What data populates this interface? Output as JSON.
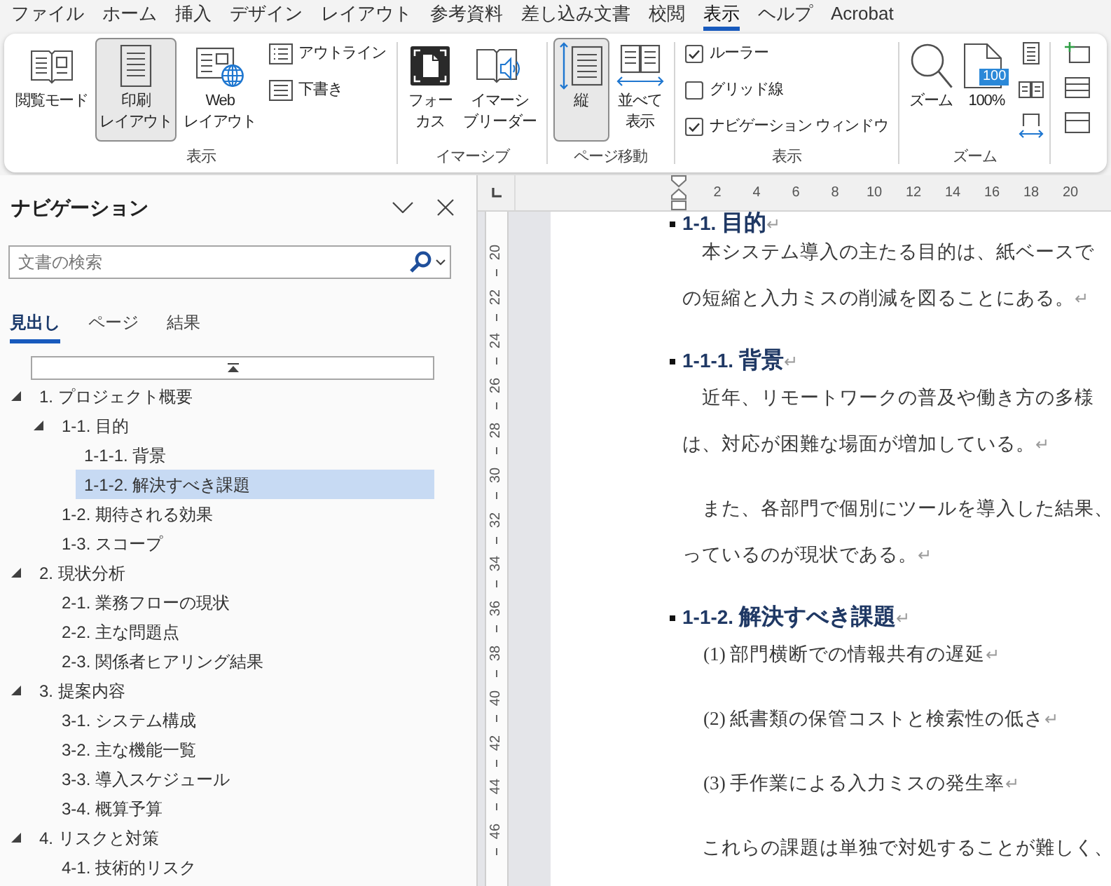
{
  "menu_tabs": [
    {
      "label": "ファイル",
      "selected": false
    },
    {
      "label": "ホーム",
      "selected": false
    },
    {
      "label": "挿入",
      "selected": false
    },
    {
      "label": "デザイン",
      "selected": false
    },
    {
      "label": "レイアウト",
      "selected": false
    },
    {
      "label": "参考資料",
      "selected": false
    },
    {
      "label": "差し込み文書",
      "selected": false
    },
    {
      "label": "校閲",
      "selected": false
    },
    {
      "label": "表示",
      "selected": true
    },
    {
      "label": "ヘルプ",
      "selected": false
    },
    {
      "label": "Acrobat",
      "selected": false
    }
  ],
  "ribbon": {
    "views": {
      "label": "表示",
      "read_mode": {
        "lines": [
          "閲覧モード"
        ],
        "selected": false
      },
      "print_layout": {
        "lines": [
          "印刷",
          "レイアウト"
        ],
        "selected": true
      },
      "web_layout": {
        "lines": [
          "Web",
          "レイアウト"
        ],
        "selected": false
      },
      "outline": {
        "label": "アウトライン",
        "selected": false
      },
      "draft": {
        "label": "下書き",
        "selected": false
      }
    },
    "immersive": {
      "label": "イマーシブ",
      "focus": {
        "lines": [
          "フォー",
          "カス"
        ]
      },
      "immersive_reader": {
        "lines": [
          "イマーシ",
          "ブリーダー"
        ]
      }
    },
    "page_movement": {
      "label": "ページ移動",
      "vertical": {
        "lines": [
          "縦"
        ],
        "selected": true
      },
      "side_to_side": {
        "lines": [
          "並べて",
          "表示"
        ],
        "selected": false
      }
    },
    "show": {
      "label": "表示",
      "options": [
        {
          "label": "ルーラー",
          "checked": true
        },
        {
          "label": "グリッド線",
          "checked": false
        },
        {
          "label": "ナビゲーション ウィンドウ",
          "checked": true
        }
      ]
    },
    "zoom": {
      "label": "ズーム",
      "zoom_button": {
        "label": "ズーム"
      },
      "hundred_percent": {
        "label": "100%",
        "badge": "100"
      }
    }
  },
  "navigation": {
    "title": "ナビゲーション",
    "search": {
      "placeholder": "文書の検索"
    },
    "tabs": [
      {
        "label": "見出し",
        "selected": true
      },
      {
        "label": "ページ",
        "selected": false
      },
      {
        "label": "結果",
        "selected": false
      }
    ],
    "headings": [
      {
        "label": "1. プロジェクト概要",
        "expanded": true,
        "selected": false,
        "children": [
          {
            "label": "1-1. 目的",
            "expanded": true,
            "selected": false,
            "children": [
              {
                "label": "1-1-1. 背景",
                "selected": false
              },
              {
                "label": "1-1-2. 解決すべき課題",
                "selected": true
              }
            ]
          },
          {
            "label": "1-2. 期待される効果",
            "selected": false
          },
          {
            "label": "1-3. スコープ",
            "selected": false
          }
        ]
      },
      {
        "label": "2. 現状分析",
        "expanded": true,
        "selected": false,
        "children": [
          {
            "label": "2-1. 業務フローの現状",
            "selected": false
          },
          {
            "label": "2-2. 主な問題点",
            "selected": false
          },
          {
            "label": "2-3. 関係者ヒアリング結果",
            "selected": false
          }
        ]
      },
      {
        "label": "3. 提案内容",
        "expanded": true,
        "selected": false,
        "children": [
          {
            "label": "3-1. システム構成",
            "selected": false
          },
          {
            "label": "3-2. 主な機能一覧",
            "selected": false
          },
          {
            "label": "3-3. 導入スケジュール",
            "selected": false
          },
          {
            "label": "3-4. 概算予算",
            "selected": false
          }
        ]
      },
      {
        "label": "4. リスクと対策",
        "expanded": true,
        "selected": false,
        "children": [
          {
            "label": "4-1. 技術的リスク",
            "selected": false
          }
        ]
      }
    ]
  },
  "document": {
    "horizontal_ruler": [
      "2",
      "4",
      "6",
      "8",
      "10",
      "12",
      "14",
      "16",
      "18",
      "20"
    ],
    "vertical_ruler": [
      "20",
      "22",
      "24",
      "26",
      "28",
      "30",
      "32",
      "34",
      "36",
      "38",
      "40",
      "42",
      "44",
      "46"
    ],
    "blocks": [
      {
        "kind": "heading",
        "number": "1-1.",
        "title": "目的",
        "mark": "↵"
      },
      {
        "kind": "paragraph",
        "lines": [
          "　本システム導入の主たる目的は、紙ベースで",
          "の短縮と入力ミスの削減を図ることにある。"
        ],
        "mark": "↵"
      },
      {
        "kind": "heading",
        "number": "1-1-1.",
        "title": "背景",
        "mark": "↵"
      },
      {
        "kind": "paragraph",
        "lines": [
          "　近年、リモートワークの普及や働き方の多様",
          "は、対応が困難な場面が増加している。"
        ],
        "mark": "↵"
      },
      {
        "kind": "paragraph",
        "lines": [
          "　また、各部門で個別にツールを導入した結果、",
          "っているのが現状である。"
        ],
        "mark": "↵"
      },
      {
        "kind": "heading",
        "number": "1-1-2.",
        "title": "解決すべき課題",
        "mark": "↵"
      },
      {
        "kind": "item",
        "text": "(1) 部門横断での情報共有の遅延",
        "mark": "↵"
      },
      {
        "kind": "item",
        "text": "(2) 紙書類の保管コストと検索性の低さ",
        "mark": "↵"
      },
      {
        "kind": "item",
        "text": "(3) 手作業による入力ミスの発生率",
        "mark": "↵"
      },
      {
        "kind": "paragraph",
        "lines": [
          "　これらの課題は単独で対処することが難しく、"
        ]
      }
    ]
  }
}
